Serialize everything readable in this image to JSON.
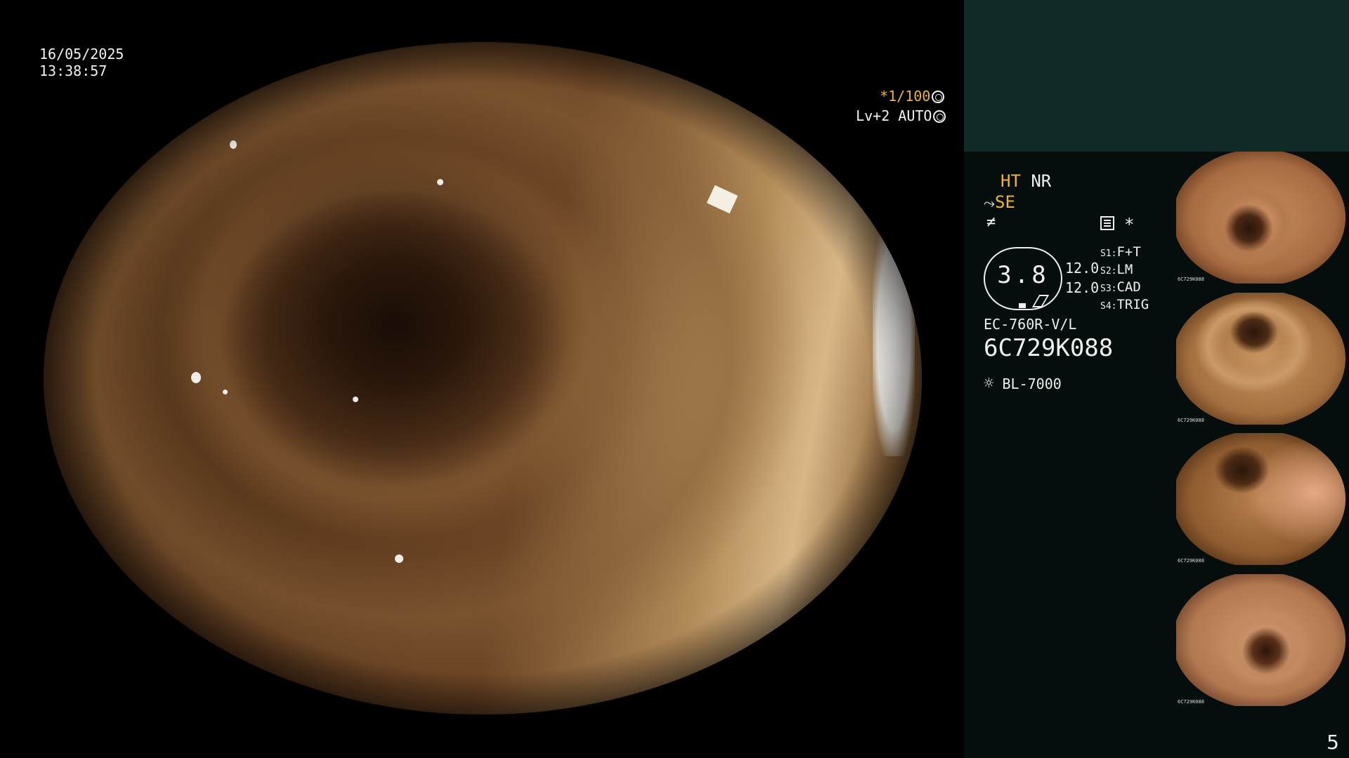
{
  "osd": {
    "date": "16/05/2025",
    "time": "13:38:57",
    "shutter": "*1/100",
    "level": "Lv+2 AUTO"
  },
  "panel": {
    "ht": "HT",
    "nr": "NR",
    "se": "SE",
    "gauge_value": "3.8",
    "val_1": "12.0",
    "val_2": "12.0",
    "s1_key": "S1:",
    "s1_val": "F+T",
    "s2_key": "S2:",
    "s2_val": "LM",
    "s3_key": "S3:",
    "s3_val": "CAD",
    "s4_key": "S4:",
    "s4_val": "TRIG",
    "scope_model": "EC-760R-V/L",
    "serial": "6C729K088",
    "light_source": "BL-7000",
    "star": "*"
  },
  "thumbnails": [
    {
      "caption": "6C729K088"
    },
    {
      "caption": "6C729K088"
    },
    {
      "caption": "6C729K088"
    },
    {
      "caption": "6C729K088"
    }
  ],
  "page_number": "5",
  "colors": {
    "osd_orange": "#f0b040",
    "panel_bg": "#050e0c",
    "top_block": "#0f2a27"
  }
}
